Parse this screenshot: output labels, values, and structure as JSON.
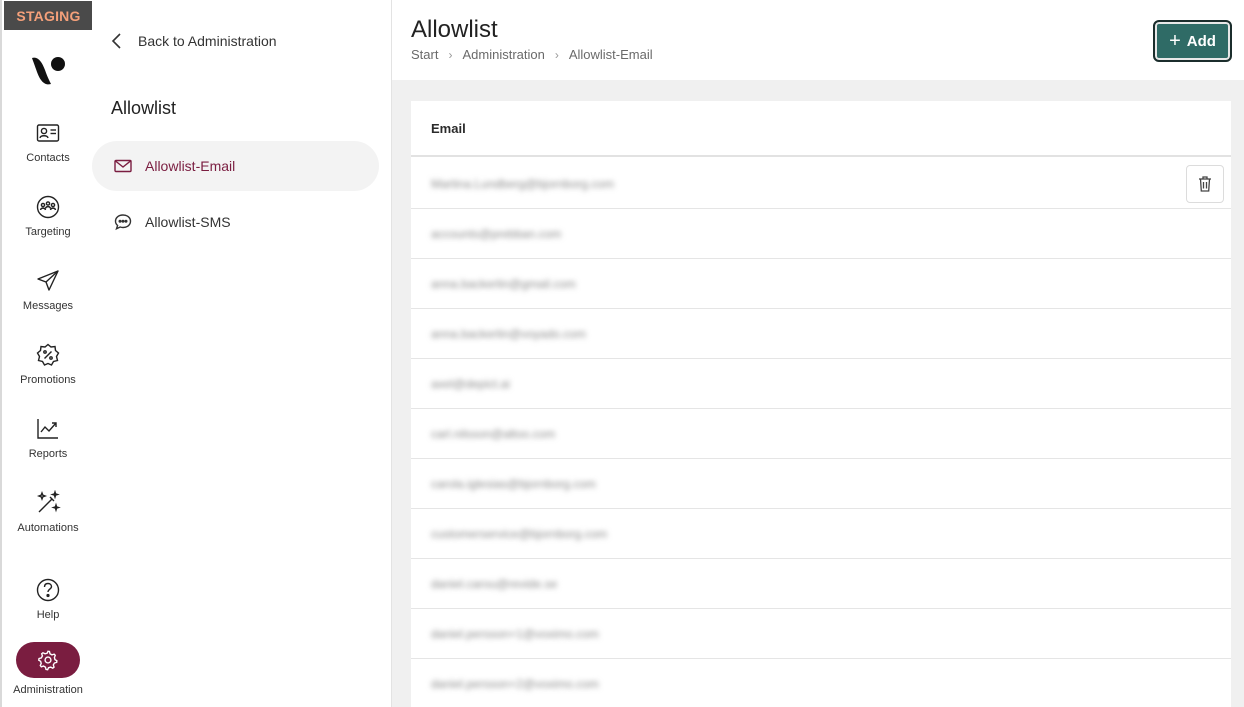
{
  "env_badge": "STAGING",
  "rail": {
    "items": [
      {
        "label": "Contacts",
        "icon": "contact-card-icon"
      },
      {
        "label": "Targeting",
        "icon": "audience-icon"
      },
      {
        "label": "Messages",
        "icon": "paper-plane-icon"
      },
      {
        "label": "Promotions",
        "icon": "discount-badge-icon"
      },
      {
        "label": "Reports",
        "icon": "chart-trend-icon"
      },
      {
        "label": "Automations",
        "icon": "magic-wand-icon"
      },
      {
        "label": "Help",
        "icon": "question-circle-icon"
      },
      {
        "label": "Administration",
        "icon": "gear-icon"
      }
    ],
    "active": "Administration"
  },
  "subnav": {
    "back_label": "Back to Administration",
    "title": "Allowlist",
    "items": [
      {
        "label": "Allowlist-Email",
        "icon": "envelope-icon"
      },
      {
        "label": "Allowlist-SMS",
        "icon": "chat-bubble-icon"
      }
    ],
    "active": "Allowlist-Email"
  },
  "header": {
    "title": "Allowlist",
    "breadcrumb": [
      "Start",
      "Administration",
      "Allowlist-Email"
    ],
    "add_label": "Add"
  },
  "table": {
    "column": "Email",
    "rows": [
      "Martina.Lundberg@bjornborg.com",
      "accounts@prebban.com",
      "anna.backerlin@gmail.com",
      "anna.backerlin@voyado.com",
      "axel@depict.ai",
      "carl.nilsson@altoo.com",
      "carola.iglesias@bjornborg.com",
      "customerservice@bjornborg.com",
      "daniel.carou@revide.se",
      "daniel.persson+1@voximo.com",
      "daniel.persson+2@voximo.com"
    ]
  },
  "colors": {
    "accent": "#7a1d40",
    "primary_button": "#2f6b66",
    "staging_bg": "#4a4a4a",
    "staging_text": "#f4a07a"
  }
}
